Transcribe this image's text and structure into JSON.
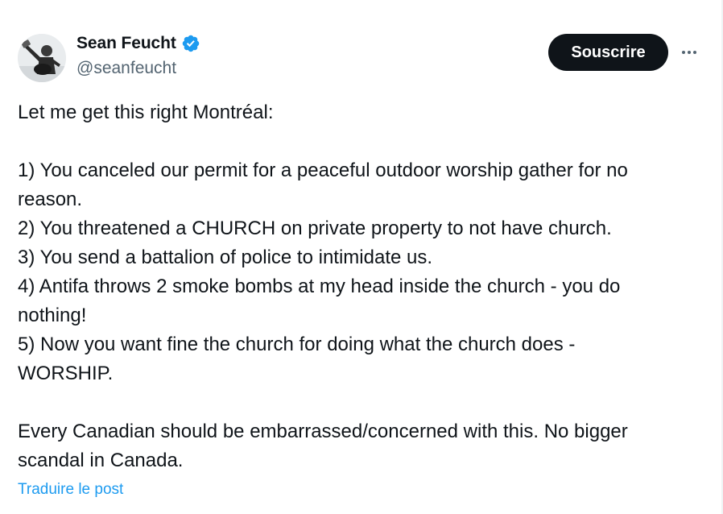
{
  "author": {
    "name": "Sean Feucht",
    "handle": "@seanfeucht",
    "verified": true,
    "verified_icon": "verified-badge-icon",
    "verified_color": "#1d9bf0"
  },
  "actions": {
    "subscribe_label": "Souscrire",
    "more_icon": "more-options-icon"
  },
  "tweet": {
    "lines": [
      "Let me get this right Montréal:",
      "",
      "1) You canceled our permit for a peaceful outdoor worship gather for no",
      "reason.",
      "2) You threatened a CHURCH on private property to not have church.",
      "3) You send a battalion of police to intimidate us.",
      "4) Antifa throws 2 smoke bombs at my head inside the church - you do",
      "nothing!",
      "5) Now you want fine the church for doing what the church does -",
      "WORSHIP.",
      "",
      "Every Canadian should be embarrassed/concerned with this. No bigger",
      "scandal in Canada."
    ]
  },
  "translate_label": "Traduire le post",
  "colors": {
    "text": "#0f1419",
    "secondary": "#536471",
    "link": "#1d9bf0",
    "button_bg": "#0f1419",
    "button_text": "#ffffff"
  }
}
